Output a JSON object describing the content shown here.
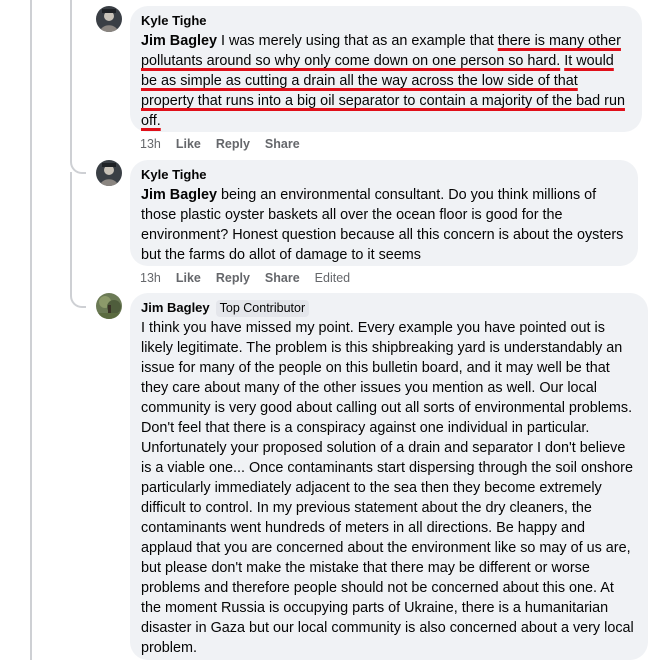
{
  "comments": [
    {
      "author": "Kyle Tighe",
      "mention": "Jim Bagley",
      "text_plain": " I was merely using that as an example that ",
      "text_marked_1": "there is many other pollutants around so why only come down on one person so hard.",
      "text_gap": " ",
      "text_marked_2": "It would be as simple as cutting a drain all the way across the low side of that property that runs into a big oil separator to contain a majority of the bad run off.",
      "time": "13h",
      "like": "Like",
      "reply": "Reply",
      "share": "Share"
    },
    {
      "author": "Kyle Tighe",
      "mention": "Jim Bagley",
      "text": " being an environmental consultant. Do you think millions of those plastic oyster baskets all over the ocean floor is good for the environment? Honest question because all this concern is about the oysters but the farms do allot of damage to it seems",
      "time": "13h",
      "like": "Like",
      "reply": "Reply",
      "share": "Share",
      "edited": "Edited"
    },
    {
      "author": "Jim Bagley",
      "badge": "Top Contributor",
      "text": "I think you have missed my point. Every example you have pointed out is likely legitimate. The problem is this shipbreaking yard is understandably an issue for many of the people on this bulletin board, and it may well be that they care about many of the other issues you mention as well. Our local community is very good about calling out all sorts of environmental problems. Don't feel that there is a conspiracy against one individual in particular. Unfortunately your proposed solution of a drain and separator I don't believe is a viable one... Once contaminants start dispersing through the soil onshore particularly immediately adjacent to the sea then they become extremely difficult to control. In my previous statement about the dry cleaners, the contaminants went hundreds of meters in all directions. Be happy and applaud that you are concerned about the environment like so may of us are, but please don't make the mistake that there may be different or worse problems and therefore people should not be concerned about this one. At the moment Russia is occupying parts of Ukraine, there is a humanitarian disaster in Gaza but our local community is also concerned about a very local problem."
    }
  ],
  "colors": {
    "bubble": "#f0f2f5",
    "underline": "#e0101a",
    "meta_text": "#65676b",
    "thread_line": "#ced0d4"
  }
}
